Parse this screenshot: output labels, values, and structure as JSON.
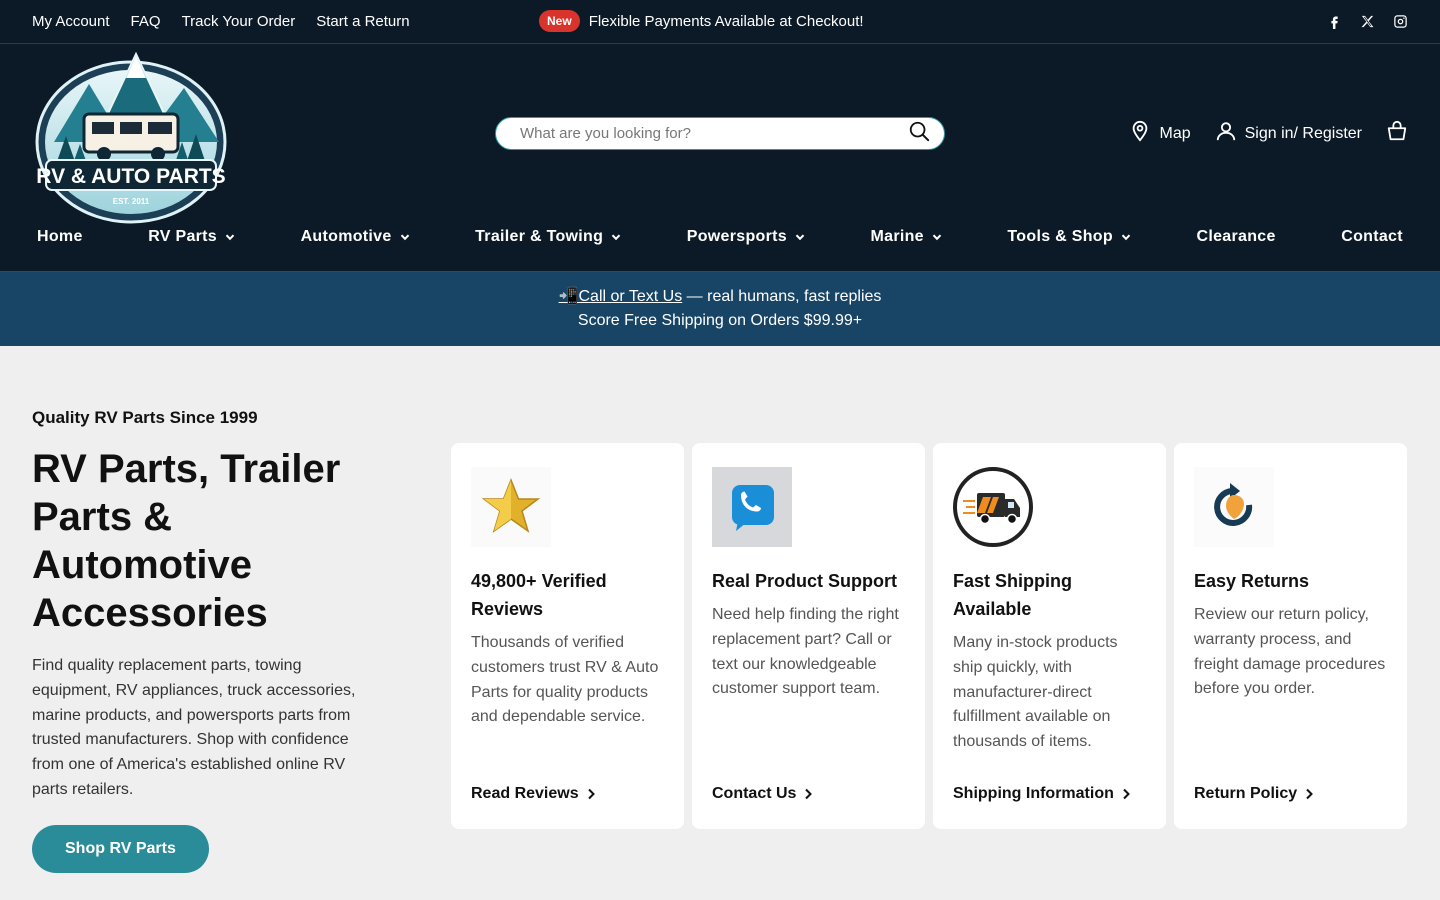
{
  "topbar": {
    "links": [
      "My Account",
      "FAQ",
      "Track Your Order",
      "Start a Return"
    ],
    "badge": "New",
    "announcement": "Flexible Payments Available at Checkout!",
    "socials": [
      "facebook-icon",
      "x-twitter-icon",
      "instagram-icon"
    ]
  },
  "header": {
    "logo": {
      "line1": "RV & AUTO PARTS",
      "line2": "EST. 2011"
    },
    "search": {
      "placeholder": "What are you looking for?"
    },
    "map_label": "Map",
    "signin_label": "Sign in/ Register"
  },
  "nav": {
    "items": [
      {
        "label": "Home",
        "dropdown": false
      },
      {
        "label": "RV Parts",
        "dropdown": true
      },
      {
        "label": "Automotive",
        "dropdown": true
      },
      {
        "label": "Trailer & Towing",
        "dropdown": true
      },
      {
        "label": "Powersports",
        "dropdown": true
      },
      {
        "label": "Marine",
        "dropdown": true
      },
      {
        "label": "Tools & Shop",
        "dropdown": true
      },
      {
        "label": "Clearance",
        "dropdown": false
      },
      {
        "label": "Contact",
        "dropdown": false
      }
    ]
  },
  "promo": {
    "phone_emoji": "📲",
    "call_link": "Call or Text Us",
    "call_suffix": " — real humans, fast replies",
    "shipping": "Score Free Shipping on Orders $99.99+"
  },
  "hero": {
    "eyebrow": "Quality RV Parts Since 1999",
    "title": "RV Parts, Trailer Parts & Automotive Accessories",
    "description": "Find quality replacement parts, towing equipment, RV appliances, truck accessories, marine products, and powersports parts from trusted manufacturers. Shop with confidence from one of America's established online RV parts retailers.",
    "button": "Shop RV Parts"
  },
  "cards": [
    {
      "icon": "star-icon",
      "title": "49,800+ Verified Reviews",
      "description": "Thousands of verified customers trust RV & Auto Parts for quality products and dependable service.",
      "link": "Read Reviews"
    },
    {
      "icon": "phone-icon",
      "title": "Real Product Support",
      "description": "Need help finding the right replacement part? Call or text our knowledgeable customer support team.",
      "link": "Contact Us"
    },
    {
      "icon": "delivery-truck-icon",
      "title": "Fast Shipping Available",
      "description": "Many in-stock products ship quickly, with manufacturer-direct fulfillment available on thousands of items.",
      "link": "Shipping Information"
    },
    {
      "icon": "return-arrow-icon",
      "title": "Easy Returns",
      "description": "Review our return policy, warranty process, and freight damage procedures before you order.",
      "link": "Return Policy"
    }
  ],
  "colors": {
    "header_bg": "#0c1a27",
    "promo_bg": "#184566",
    "accent": "#2a8c99",
    "badge": "#d9342b"
  }
}
